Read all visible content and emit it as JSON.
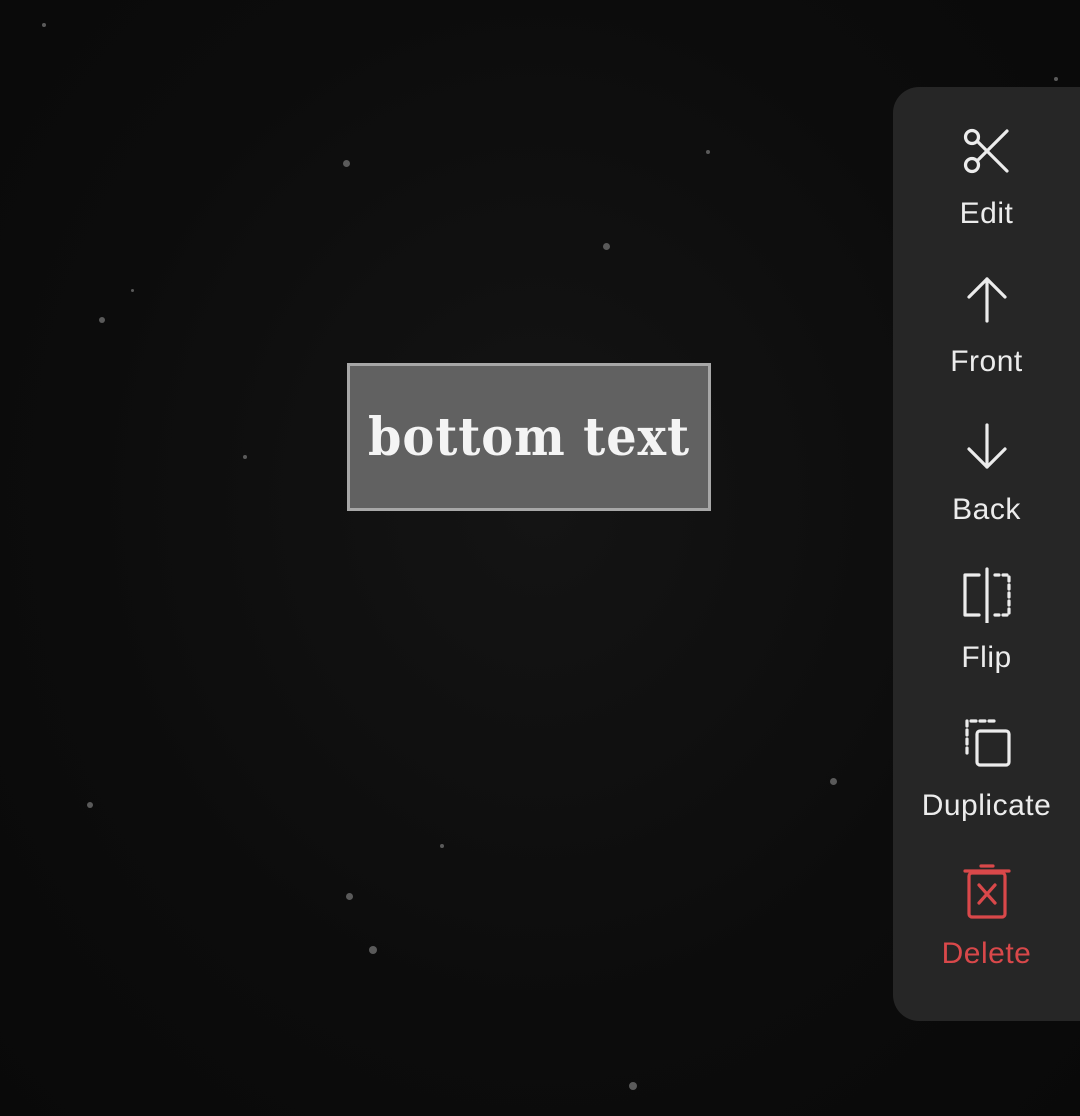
{
  "canvas": {
    "element_text": "bottom text"
  },
  "toolbar": {
    "items": [
      {
        "id": "edit",
        "label": "Edit",
        "icon": "scissors-icon"
      },
      {
        "id": "front",
        "label": "Front",
        "icon": "arrow-up-icon"
      },
      {
        "id": "back",
        "label": "Back",
        "icon": "arrow-down-icon"
      },
      {
        "id": "flip",
        "label": "Flip",
        "icon": "flip-horizontal-icon"
      },
      {
        "id": "duplicate",
        "label": "Duplicate",
        "icon": "duplicate-icon"
      },
      {
        "id": "delete",
        "label": "Delete",
        "icon": "trash-x-icon"
      }
    ]
  },
  "colors": {
    "background": "#0c0c0c",
    "toolbar": "#262626",
    "text_box_fill": "#616161",
    "text_box_border": "#a7a7a7",
    "label": "#ececec",
    "danger": "#d9484a"
  }
}
